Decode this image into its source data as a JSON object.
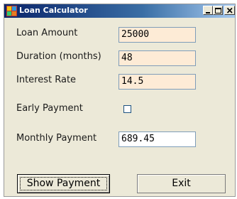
{
  "window": {
    "title": "Loan Calculator"
  },
  "fields": {
    "loan_amount": {
      "label": "Loan Amount",
      "value": "25000"
    },
    "duration": {
      "label": "Duration (months)",
      "value": "48"
    },
    "interest_rate": {
      "label": "Interest Rate",
      "value": "14.5"
    },
    "early_payment": {
      "label": "Early Payment",
      "checked": false
    },
    "monthly_payment": {
      "label": "Monthly Payment",
      "value": "689.45"
    }
  },
  "buttons": {
    "show_payment": "Show Payment",
    "exit": "Exit"
  },
  "icons": {
    "app": "app-icon",
    "minimize": "minimize-icon",
    "maximize": "maximize-icon",
    "close": "close-icon"
  },
  "colors": {
    "input_background": "#fdebd6",
    "window_background": "#ece9d8",
    "titlebar_start": "#0a246a",
    "titlebar_end": "#a6caf0"
  }
}
